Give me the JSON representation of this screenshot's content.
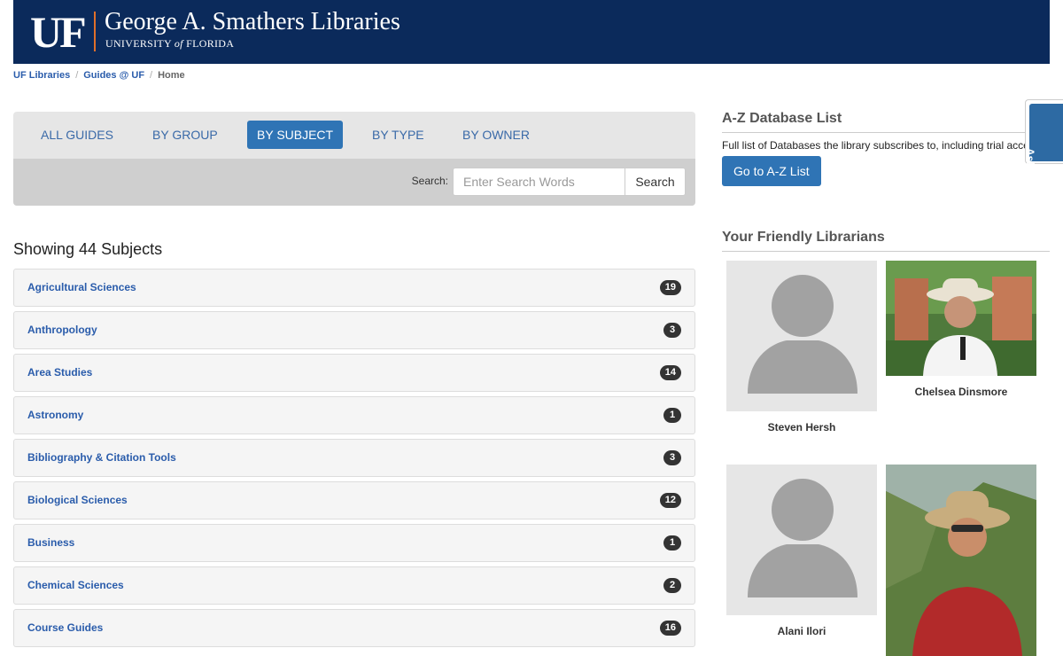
{
  "header": {
    "logo_text": "UF",
    "title": "George A. Smathers Libraries",
    "subtitle_pre": "UNIVERSITY",
    "subtitle_of": "of",
    "subtitle_post": "FLORIDA",
    "brand_color": "#0b2a5b",
    "accent_color": "#e0702a"
  },
  "breadcrumb": [
    "UF Libraries",
    "Guides @ UF",
    "Home"
  ],
  "tabs": [
    {
      "label": "ALL GUIDES",
      "active": false
    },
    {
      "label": "BY GROUP",
      "active": false
    },
    {
      "label": "BY SUBJECT",
      "active": true
    },
    {
      "label": "BY TYPE",
      "active": false
    },
    {
      "label": "BY OWNER",
      "active": false
    }
  ],
  "search": {
    "label": "Search:",
    "placeholder": "Enter Search Words",
    "button": "Search"
  },
  "showing": "Showing 44 Subjects",
  "subjects": [
    {
      "name": "Agricultural Sciences",
      "count": "19"
    },
    {
      "name": "Anthropology",
      "count": "3"
    },
    {
      "name": "Area Studies",
      "count": "14"
    },
    {
      "name": "Astronomy",
      "count": "1"
    },
    {
      "name": "Bibliography & Citation Tools",
      "count": "3"
    },
    {
      "name": "Biological Sciences",
      "count": "12"
    },
    {
      "name": "Business",
      "count": "1"
    },
    {
      "name": "Chemical Sciences",
      "count": "2"
    },
    {
      "name": "Course Guides",
      "count": "16"
    }
  ],
  "az": {
    "heading": "A-Z Database List",
    "description": "Full list of Databases the library subscribes to, including trial access",
    "button": "Go to A-Z List"
  },
  "librarians": {
    "heading": "Your Friendly Librarians",
    "people": [
      {
        "name": "Steven Hersh",
        "photo": "placeholder-avatar"
      },
      {
        "name": "Chelsea Dinsmore",
        "photo": "photo"
      },
      {
        "name": "Alani Ilori",
        "photo": "placeholder-avatar"
      },
      {
        "name": "",
        "photo": "photo"
      }
    ]
  },
  "ask_us": "Ask Us!"
}
